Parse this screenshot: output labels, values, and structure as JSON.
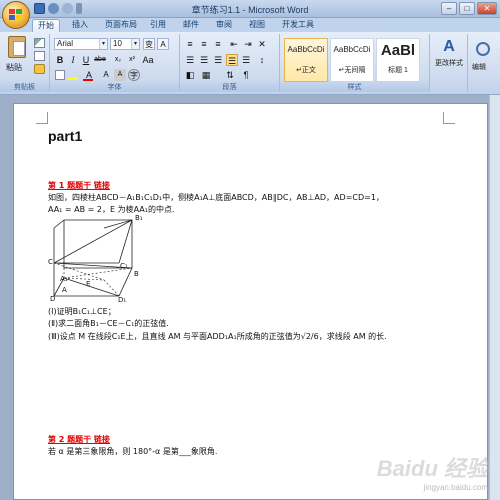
{
  "window": {
    "title": "章节练习1.1 - Microsoft Word"
  },
  "tabs": [
    "开始",
    "插入",
    "页面布局",
    "引用",
    "邮件",
    "审阅",
    "视图",
    "开发工具"
  ],
  "ribbon": {
    "clipboard": {
      "paste_label": "粘贴",
      "group_label": "剪贴板"
    },
    "font": {
      "font_name": "Arial",
      "font_size": "10",
      "group_label": "字体",
      "sub_label": "abe"
    },
    "paragraph": {
      "group_label": "段落"
    },
    "styles": {
      "group_label": "样式",
      "cards": [
        {
          "sample": "AaBbCcDi",
          "name": "↵正文"
        },
        {
          "sample": "AaBbCcDi",
          "name": "↵无间隔"
        },
        {
          "sample": "AaBl",
          "name": "标题 1"
        }
      ],
      "change_styles": "更改样式"
    },
    "editing": {
      "label": "编辑"
    }
  },
  "document": {
    "part_title": "part1",
    "q1": {
      "head": "第 1 题题干  链接",
      "line1": "如图，四棱柱ABCD－A₁B₁C₁D₁中，侧棱A₁A⊥底面ABCD，AB∥DC，AB⊥AD，AD=CD=1，",
      "line2": "AA₁ = AB = 2，E 为棱AA₁的中点.",
      "part1": "(Ⅰ)证明B₁C₁⊥CE；",
      "part2": "(Ⅱ)求二面角B₁－CE－C₁的正弦值.",
      "part3": "(Ⅲ)设点 M 在线段C₁E上，且直线 AM 与平面ADD₁A₁所成角的正弦值为√2/6，求线段 AM 的长."
    },
    "figure_labels": {
      "A1": "A₁",
      "B1": "B₁",
      "C": "C",
      "C1": "C₁",
      "D": "D",
      "D1": "D₁",
      "A": "A",
      "B": "B",
      "E": "E"
    },
    "q2": {
      "head": "第 2 题题干  链接",
      "line1": "若 α 是第三象限角，则 180°-α 是第___象限角."
    }
  },
  "watermark": {
    "main": "Baidu 经验",
    "sub": "jingyan.baidu.com"
  }
}
